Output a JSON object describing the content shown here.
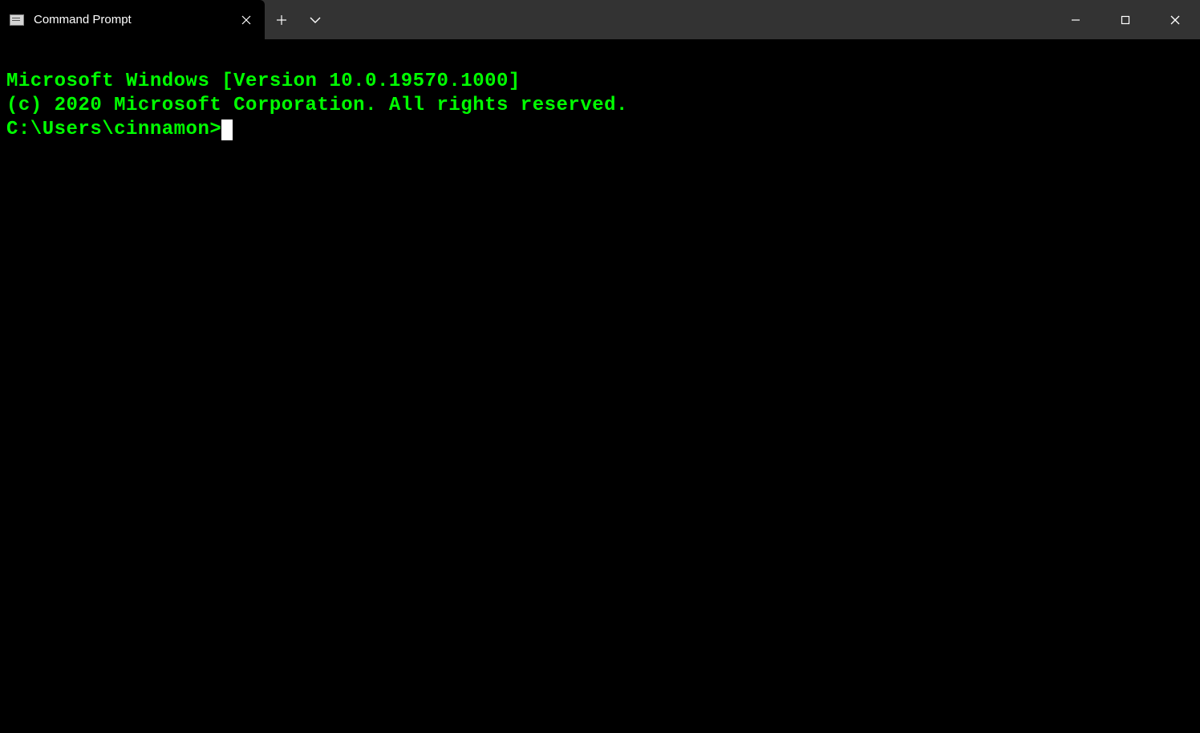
{
  "titlebar": {
    "tab_title": "Command Prompt"
  },
  "terminal": {
    "line1": "Microsoft Windows [Version 10.0.19570.1000]",
    "line2": "(c) 2020 Microsoft Corporation. All rights reserved.",
    "blank": "",
    "prompt": "C:\\Users\\cinnamon>"
  }
}
